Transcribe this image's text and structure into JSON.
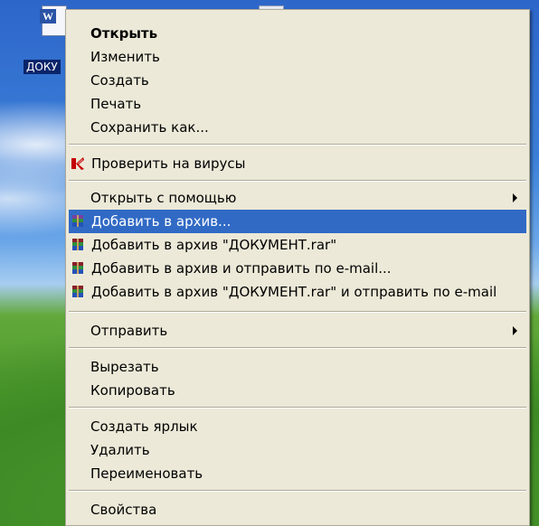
{
  "desktop": {
    "icon_label": "ДОКУ"
  },
  "menu": {
    "items": [
      {
        "label": "Открыть"
      },
      {
        "label": "Изменить"
      },
      {
        "label": "Создать"
      },
      {
        "label": "Печать"
      },
      {
        "label": "Сохранить как..."
      },
      {
        "label": "Проверить на вирусы"
      },
      {
        "label": "Открыть с помощью"
      },
      {
        "label": "Добавить в архив..."
      },
      {
        "label": "Добавить в архив \"ДОКУМЕНТ.rar\""
      },
      {
        "label": "Добавить в архив и отправить по e-mail..."
      },
      {
        "label": "Добавить в архив \"ДОКУМЕНТ.rar\" и отправить по e-mail"
      },
      {
        "label": "Отправить"
      },
      {
        "label": "Вырезать"
      },
      {
        "label": "Копировать"
      },
      {
        "label": "Создать ярлык"
      },
      {
        "label": "Удалить"
      },
      {
        "label": "Переименовать"
      },
      {
        "label": "Свойства"
      }
    ]
  },
  "colors": {
    "menu_bg": "#ece9d8",
    "highlight": "#316ac5"
  }
}
